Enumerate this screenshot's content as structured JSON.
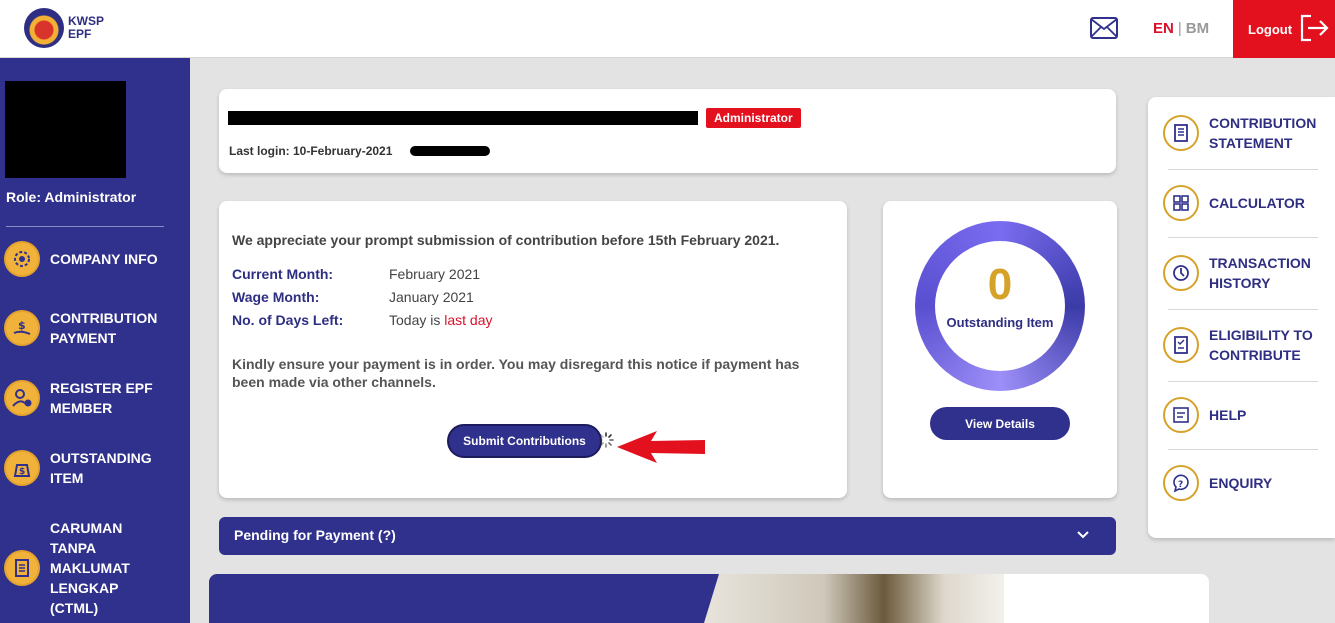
{
  "header": {
    "logo_line1": "KWSP",
    "logo_line2": "EPF",
    "lang_en": "EN",
    "lang_sep": "|",
    "lang_bm": "BM",
    "logout_label": "Logout"
  },
  "sidebar": {
    "role": "Role: Administrator",
    "items": [
      {
        "label": "COMPANY INFO"
      },
      {
        "label": "CONTRIBUTION PAYMENT"
      },
      {
        "label": "REGISTER EPF MEMBER"
      },
      {
        "label": "OUTSTANDING ITEM"
      },
      {
        "label": "CARUMAN TANPA MAKLUMAT LENGKAP (CTML)"
      }
    ]
  },
  "user_card": {
    "badge": "Administrator",
    "last_login": "Last login: 10-February-2021"
  },
  "notice": {
    "heading": "We appreciate your prompt submission of contribution before 15th February 2021.",
    "rows": [
      {
        "key": "Current Month:",
        "value": "February 2021"
      },
      {
        "key": "Wage Month:",
        "value": "January 2021"
      },
      {
        "key": "No. of Days Left:",
        "value_prefix": "Today is ",
        "value_highlight": "last day"
      }
    ],
    "footer": "Kindly ensure your payment is in order. You may disregard this notice if payment has been made via other channels.",
    "submit_label": "Submit Contributions"
  },
  "outstanding": {
    "count": "0",
    "label": "Outstanding Item",
    "view_label": "View Details"
  },
  "pending": {
    "label": "Pending for Payment (?)"
  },
  "right_panel": {
    "items": [
      {
        "label": "CONTRIBUTION STATEMENT"
      },
      {
        "label": "CALCULATOR"
      },
      {
        "label": "TRANSACTION HISTORY"
      },
      {
        "label": "ELIGIBILITY TO CONTRIBUTE"
      },
      {
        "label": "HELP"
      },
      {
        "label": "ENQUIRY"
      }
    ]
  },
  "colors": {
    "primary": "#30308d",
    "accent_red": "#e3101e",
    "gold": "#d6a32a"
  }
}
